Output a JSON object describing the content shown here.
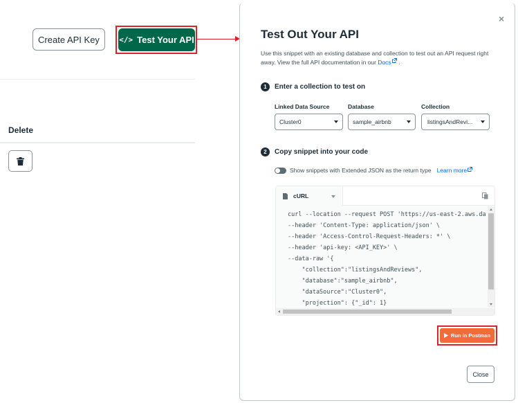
{
  "background": {
    "create_api_key_label": "Create API Key",
    "test_api_label": "Test Your API",
    "delete_column_header": "Delete"
  },
  "modal": {
    "close_glyph": "×",
    "title": "Test Out Your API",
    "description_part1": "Use this snippet with an existing database and collection to test out an API request right away. View the full API documentation in our ",
    "docs_link": "Docs",
    "description_end": ".",
    "step1": {
      "number": "1",
      "label": "Enter a collection to test on"
    },
    "fields": {
      "linked_data_source": {
        "label": "Linked Data Source",
        "value": "Cluster0"
      },
      "database": {
        "label": "Database",
        "value": "sample_airbnb"
      },
      "collection": {
        "label": "Collection",
        "value": "listingsAndRevi..."
      }
    },
    "step2": {
      "number": "2",
      "label": "Copy snippet into your code"
    },
    "toggle_label": "Show snippets with Extended JSON as the return type",
    "learn_more": "Learn more",
    "code": {
      "language": "cURL",
      "lines": [
        "curl --location --request POST 'https://us-east-2.aws.da",
        "--header 'Content-Type: application/json' \\",
        "--header 'Access-Control-Request-Headers: *' \\",
        "--header 'api-key: <API_KEY>' \\",
        "--data-raw '{",
        "    \"collection\":\"listingsAndReviews\",",
        "    \"database\":\"sample_airbnb\",",
        "    \"dataSource\":\"Cluster0\",",
        "    \"projection\": {\"_id\": 1}"
      ]
    },
    "run_in_postman": "Run in Postman",
    "close_button": "Close"
  },
  "colors": {
    "primary_green": "#00684a",
    "highlight_red": "#d9242a",
    "postman_orange": "#f26b3a",
    "link_blue": "#016bf8"
  }
}
